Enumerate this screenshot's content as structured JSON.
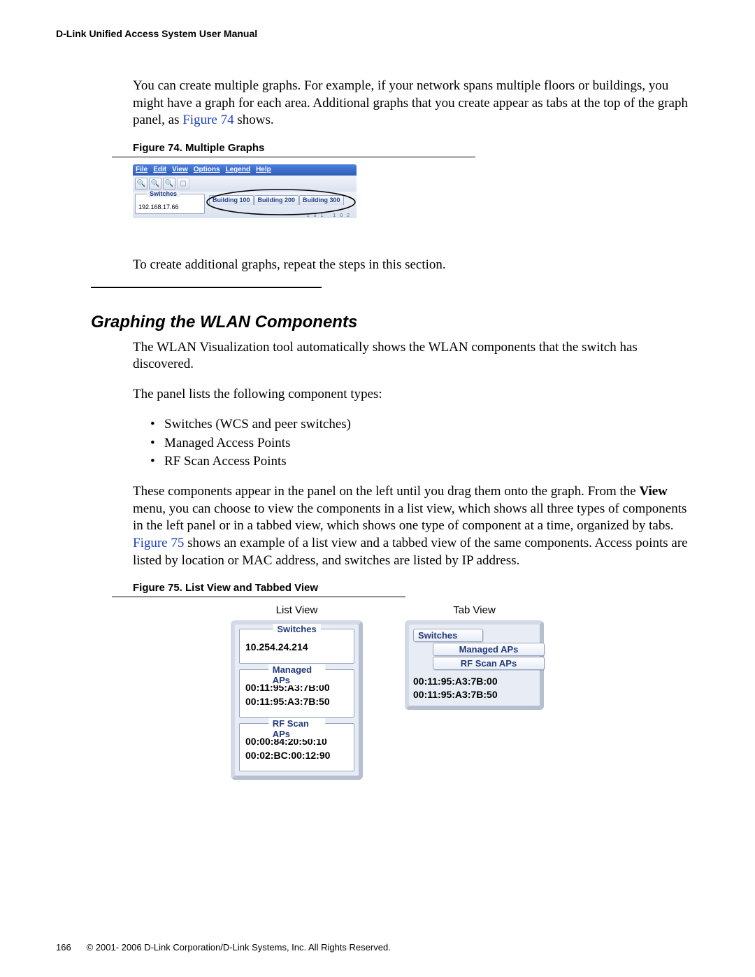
{
  "header": "D-Link Unified Access System User Manual",
  "intro_a": "You can create multiple graphs. For example, if your network spans multiple floors or buildings, you might have a graph for each area. Additional graphs that you create appear as tabs at the top of the graph panel, as ",
  "intro_link1": "Figure 74",
  "intro_b": " shows.",
  "fig74_caption": "Figure 74.  Multiple Graphs",
  "fig74": {
    "menu": [
      "File",
      "Edit",
      "View",
      "Options",
      "Legend",
      "Help"
    ],
    "switches_title": "Switches",
    "switch_ip": "192.168.17.66",
    "tabs": [
      "Building 100",
      "Building 200",
      "Building 300"
    ],
    "ticks": "101  102"
  },
  "after_fig74": "To create additional graphs, repeat the steps in this section.",
  "section": "Graphing the WLAN Components",
  "sec_p1": "The WLAN Visualization tool automatically shows the WLAN components that the switch has discovered.",
  "sec_p2": "The panel lists the following component types:",
  "bullets": [
    "Switches (WCS and peer switches)",
    "Managed Access Points",
    "RF Scan Access Points"
  ],
  "sec_p3a": "These components appear in the panel on the left until you drag them onto the graph. From the ",
  "sec_p3_view": "View",
  "sec_p3b": " menu, you can choose to view the components in a list view, which shows all three types of components in the left panel or in a tabbed view, which shows one type of component at a time, organized by tabs. ",
  "sec_p3_link": "Figure 75",
  "sec_p3c": " shows an example of a list view and a tabbed view of the same components. Access points are listed by location or MAC address, and switches are listed by IP address.",
  "fig75_caption": "Figure 75.  List View and Tabbed View",
  "fig75": {
    "list_label": "List View",
    "tab_label": "Tab View",
    "switches_title": "Switches",
    "switches_items": [
      "10.254.24.214"
    ],
    "managed_title": "Managed APs",
    "managed_items": [
      "00:11:95:A3:7B:00",
      "00:11:95:A3:7B:50"
    ],
    "rfscan_title": "RF Scan APs",
    "rfscan_items": [
      "00:00:84:20:50:10",
      "00:02:BC:00:12:90"
    ],
    "tab_titles": [
      "Switches",
      "Managed APs",
      "RF Scan APs"
    ],
    "tab_macs": [
      "00:11:95:A3:7B:00",
      "00:11:95:A3:7B:50"
    ]
  },
  "footer_page": "166",
  "footer_copy": "© 2001- 2006 D-Link Corporation/D-Link Systems, Inc. All Rights Reserved."
}
